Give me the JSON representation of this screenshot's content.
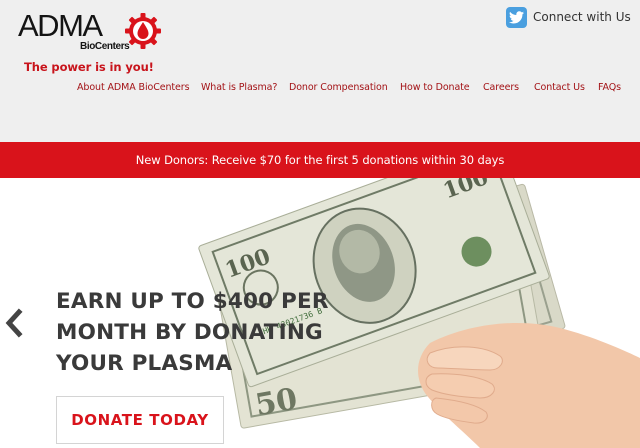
{
  "brand": {
    "name": "ADMA",
    "sub": "BioCenters",
    "tagline": "The power is in you!",
    "accent_color": "#d9131b",
    "logo_icon": "gear-drop-icon"
  },
  "social": {
    "label": "Connect with Us",
    "icon": "twitter-icon",
    "icon_color": "#4a9fdf"
  },
  "nav": {
    "items": [
      {
        "label": "About ADMA BioCenters"
      },
      {
        "label": "What is Plasma?"
      },
      {
        "label": "Donor Compensation"
      },
      {
        "label": "How to Donate"
      },
      {
        "label": "Careers"
      },
      {
        "label": "Contact Us"
      },
      {
        "label": "FAQs"
      }
    ]
  },
  "promo": {
    "text": "New Donors: Receive $70 for the first 5 donations within 30 days"
  },
  "hero": {
    "headline_lines": [
      "EARN UP TO $400 PER",
      "MONTH BY DONATING",
      "YOUR PLASMA"
    ],
    "cta_label": "DONATE TODAY",
    "prev_icon": "chevron-left-icon",
    "image": "hand-holding-dollar-bills"
  }
}
